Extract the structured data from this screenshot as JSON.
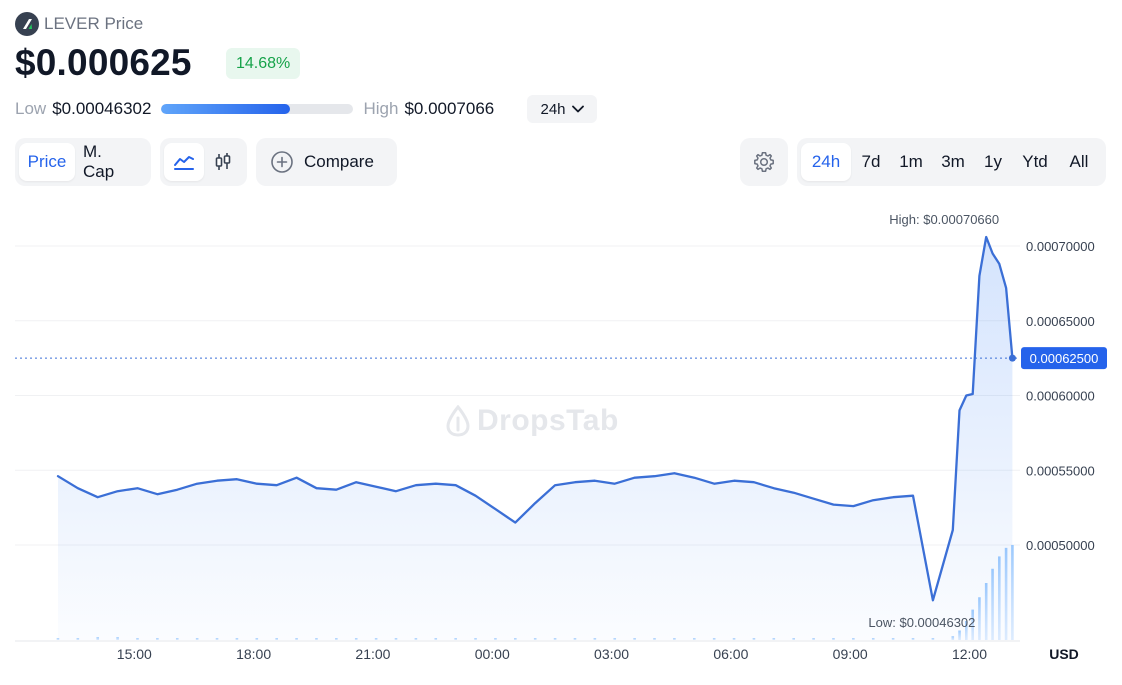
{
  "header": {
    "token_name": "LEVER Price",
    "price": "$0.000625",
    "change": "14.68%",
    "low_label": "Low",
    "low_value": "$0.00046302",
    "high_label": "High",
    "high_value": "$0.0007066",
    "range_position": 0.67,
    "period": "24h"
  },
  "toolbar": {
    "metric_tabs": [
      "Price",
      "M. Cap"
    ],
    "active_metric": "Price",
    "compare_label": "Compare",
    "time_ranges": [
      "24h",
      "7d",
      "1m",
      "3m",
      "1y",
      "Ytd",
      "All"
    ],
    "active_range": "24h"
  },
  "colors": {
    "accent": "#2563eb",
    "line": "#3b6fd6",
    "positive": "#16a34a",
    "positive_bg": "#e8f7ee"
  },
  "watermark": "DropsTab",
  "chart_data": {
    "type": "area",
    "currency": "USD",
    "x_ticks": [
      "15:00",
      "18:00",
      "21:00",
      "00:00",
      "03:00",
      "06:00",
      "09:00",
      "12:00"
    ],
    "y_ticks": [
      "0.00070000",
      "0.00065000",
      "0.00060000",
      "0.00055000",
      "0.00050000"
    ],
    "ylim": [
      0.00043735,
      0.0007066
    ],
    "current_value": 0.000625,
    "current_label": "0.00062500",
    "high_annotation": "High: $0.00070660",
    "low_annotation": "Low: $0.00046302",
    "x": [
      13.08,
      13.58,
      14.08,
      14.58,
      15.08,
      15.58,
      16.08,
      16.58,
      17.08,
      17.58,
      18.08,
      18.58,
      19.08,
      19.58,
      20.08,
      20.58,
      21.08,
      21.58,
      22.08,
      22.58,
      23.08,
      23.58,
      24.08,
      24.58,
      25.08,
      25.58,
      26.08,
      26.58,
      27.08,
      27.58,
      28.08,
      28.58,
      29.08,
      29.58,
      30.08,
      30.58,
      31.08,
      31.58,
      32.08,
      32.58,
      33.08,
      33.58,
      34.08,
      34.58,
      35.08,
      35.58,
      35.75,
      35.92,
      36.08,
      36.25,
      36.42,
      36.58,
      36.75,
      36.92,
      37.08
    ],
    "series": [
      {
        "values": [
          0.000546,
          0.000538,
          0.000532,
          0.000536,
          0.000538,
          0.000534,
          0.000537,
          0.000541,
          0.000543,
          0.000544,
          0.000541,
          0.00054,
          0.000545,
          0.000538,
          0.000537,
          0.000542,
          0.000539,
          0.000536,
          0.00054,
          0.000541,
          0.00054,
          0.000533,
          0.000524,
          0.000515,
          0.000528,
          0.00054,
          0.000542,
          0.000543,
          0.000541,
          0.000545,
          0.000546,
          0.000548,
          0.000545,
          0.000541,
          0.000543,
          0.000542,
          0.000538,
          0.000535,
          0.000531,
          0.000527,
          0.000526,
          0.00053,
          0.000532,
          0.000533,
          0.000463,
          0.00051,
          0.00059,
          0.0006,
          0.000601,
          0.00068,
          0.000706,
          0.000695,
          0.000688,
          0.000672,
          0.000625
        ]
      }
    ],
    "volume_values": [
      0.02,
      0.02,
      0.03,
      0.03,
      0.02,
      0.02,
      0.02,
      0.02,
      0.02,
      0.02,
      0.02,
      0.02,
      0.02,
      0.02,
      0.02,
      0.02,
      0.02,
      0.02,
      0.02,
      0.02,
      0.02,
      0.02,
      0.02,
      0.02,
      0.02,
      0.02,
      0.02,
      0.02,
      0.02,
      0.02,
      0.02,
      0.02,
      0.02,
      0.02,
      0.02,
      0.02,
      0.02,
      0.02,
      0.02,
      0.02,
      0.02,
      0.02,
      0.02,
      0.02,
      0.02,
      0.04,
      0.1,
      0.2,
      0.32,
      0.45,
      0.6,
      0.75,
      0.88,
      0.97,
      1.0
    ],
    "grid": true,
    "legend": "none"
  }
}
